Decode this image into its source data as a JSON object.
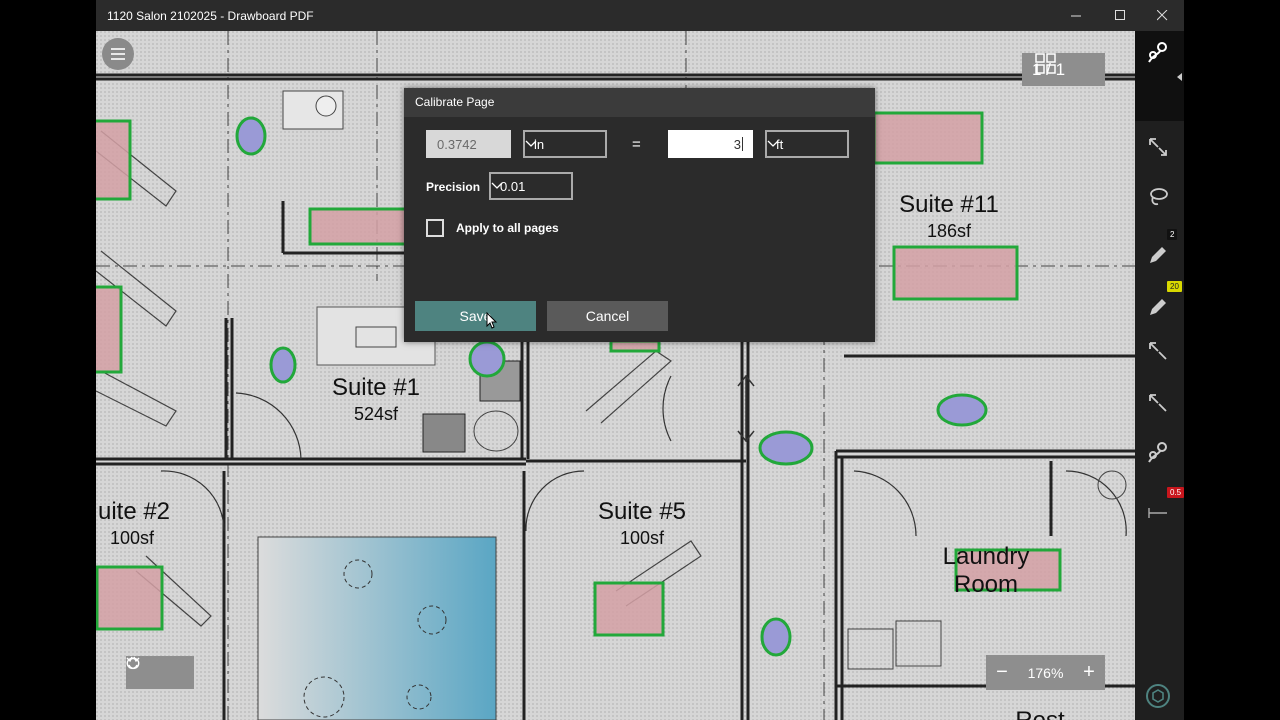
{
  "window": {
    "title": "1120 Salon 2102025 - Drawboard PDF"
  },
  "page_indicator": "1 / 1",
  "zoom": {
    "minus": "−",
    "value": "176%",
    "plus": "+"
  },
  "rail_badges": {
    "pen": "2",
    "highlighter": "20",
    "measure": "0.5"
  },
  "floorplan": {
    "labels": [
      "Suite #11",
      "186sf",
      "Suite #1",
      "524sf",
      "uite #2",
      "100sf",
      "Suite #5",
      "100sf",
      "Laundry",
      "Room",
      "Rest"
    ]
  },
  "dialog": {
    "title": "Calibrate Page",
    "measured_value": "0.3742",
    "measured_unit": "in",
    "equals": "=",
    "real_value": "3",
    "real_unit": "ft",
    "precision_label": "Precision",
    "precision_value": "0.01",
    "apply_all_label": "Apply to all pages",
    "apply_all_checked": false,
    "save_label": "Save",
    "cancel_label": "Cancel"
  },
  "colors": {
    "accent_save": "#4e8380",
    "area_fill": "#d4a0a5",
    "area_stroke": "#22a83a",
    "ellipse_fill": "#9a9ad6"
  }
}
